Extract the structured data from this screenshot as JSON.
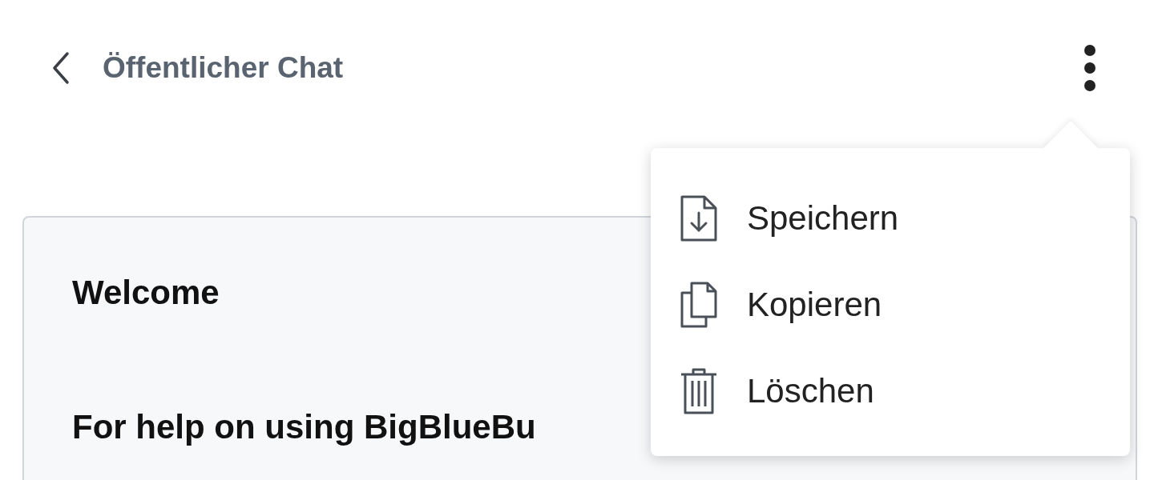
{
  "header": {
    "title": "Öffentlicher Chat"
  },
  "card": {
    "title": "Welcome",
    "text": "For help on using BigBlueBu"
  },
  "menu": {
    "items": [
      {
        "kind": "save",
        "label": "Speichern"
      },
      {
        "kind": "copy",
        "label": "Kopieren"
      },
      {
        "kind": "delete",
        "label": "Löschen"
      }
    ]
  }
}
